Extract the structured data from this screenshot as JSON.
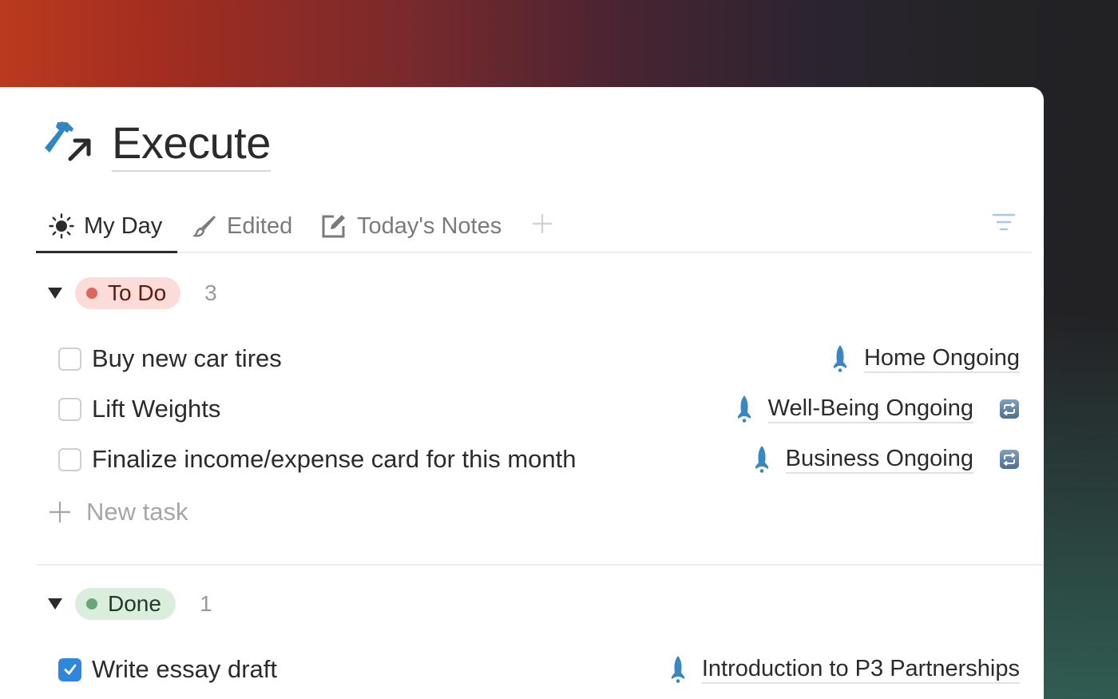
{
  "page": {
    "title": "Execute",
    "icon": "hammer-arrow-icon"
  },
  "tabs": [
    {
      "label": "My Day",
      "icon": "sun-icon",
      "active": true
    },
    {
      "label": "Edited",
      "icon": "paintbrush-icon",
      "active": false
    },
    {
      "label": "Today's Notes",
      "icon": "edit-note-icon",
      "active": false
    }
  ],
  "toolbar": {
    "add_tab_icon": "plus-icon",
    "filter_icon": "filter-icon"
  },
  "groups": {
    "todo": {
      "label": "To Do",
      "count": "3",
      "color": "#e06459",
      "expanded": true,
      "tasks": [
        {
          "title": "Buy new car tires",
          "checked": false,
          "project": "Home Ongoing",
          "repeat": false
        },
        {
          "title": "Lift Weights",
          "checked": false,
          "project": "Well-Being Ongoing",
          "repeat": true
        },
        {
          "title": "Finalize income/expense card for this month",
          "checked": false,
          "project": "Business Ongoing",
          "repeat": true
        }
      ],
      "new_task_label": "New task"
    },
    "done": {
      "label": "Done",
      "count": "1",
      "color": "#6aa57a",
      "expanded": true,
      "tasks": [
        {
          "title": "Write essay draft",
          "checked": true,
          "project": "Introduction to P3 Partnerships",
          "repeat": false
        }
      ]
    }
  },
  "colors": {
    "accent_blue": "#2e87dd",
    "rocket_blue": "#3a86c0",
    "text": "#2b2b2b",
    "muted": "#7a7a7a"
  }
}
